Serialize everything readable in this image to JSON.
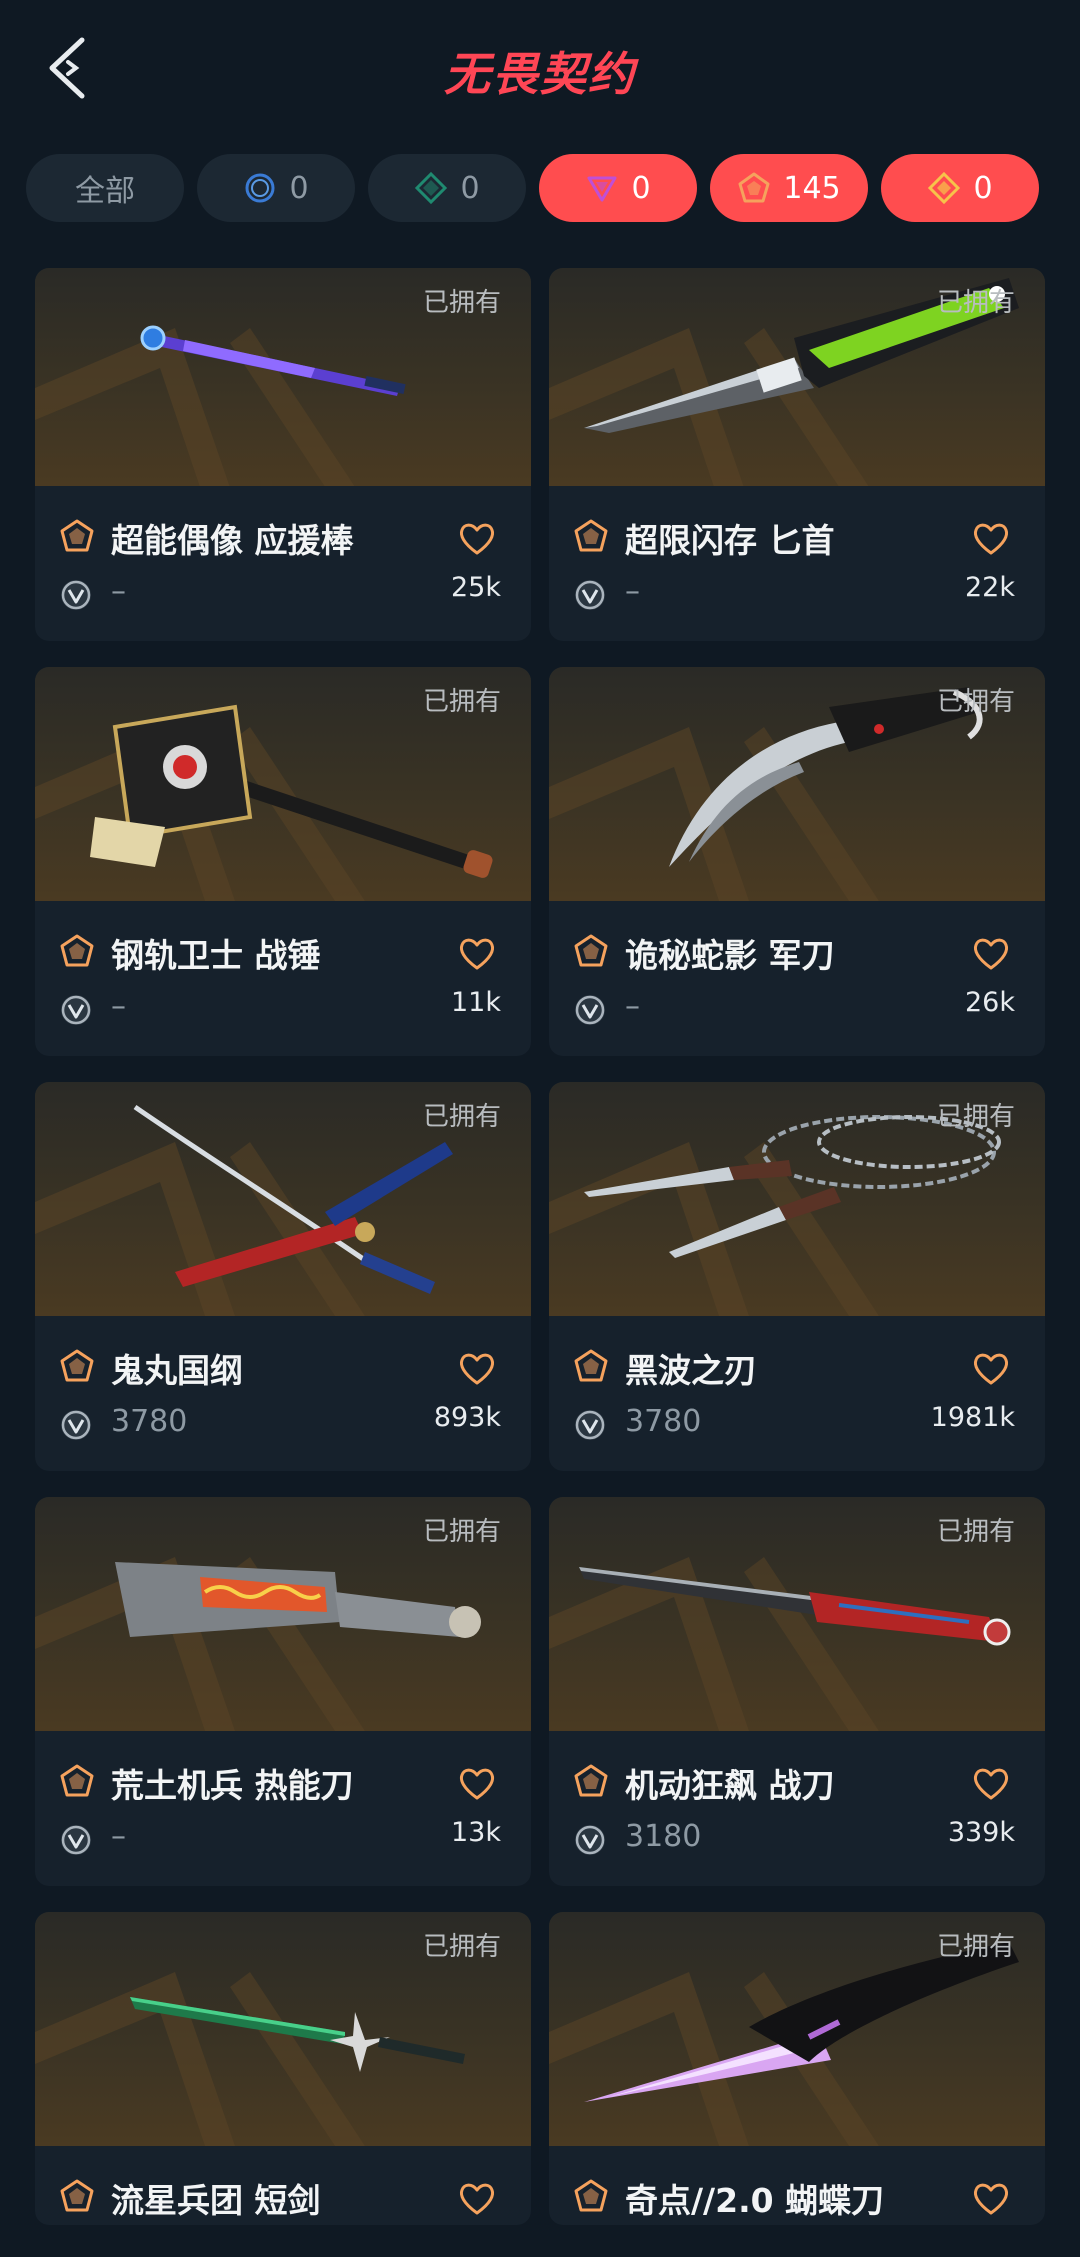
{
  "header": {
    "title": "无畏契约"
  },
  "filters": [
    {
      "label": "全部",
      "count": null,
      "active": false
    },
    {
      "icon": "circle-ring-icon",
      "count": "0",
      "active": false,
      "color": "#3a7bd5"
    },
    {
      "icon": "diamond-green-icon",
      "count": "0",
      "active": false,
      "color": "#1f8a70"
    },
    {
      "icon": "triangle-purple-icon",
      "count": "0",
      "active": true,
      "color": "#c04fd6"
    },
    {
      "icon": "pentagon-orange-icon",
      "count": "145",
      "active": true,
      "color": "#f5a25d"
    },
    {
      "icon": "diamond-yellow-icon",
      "count": "0",
      "active": true,
      "color": "#f7c34a"
    }
  ],
  "owned_label": "已拥有",
  "items": [
    {
      "name": "超能偶像 应援棒",
      "price": "–",
      "likes": "25k"
    },
    {
      "name": "超限闪存 匕首",
      "price": "–",
      "likes": "22k"
    },
    {
      "name": "钢轨卫士 战锤",
      "price": "–",
      "likes": "11k"
    },
    {
      "name": "诡秘蛇影 军刀",
      "price": "–",
      "likes": "26k"
    },
    {
      "name": "鬼丸国纲",
      "price": "3780",
      "likes": "893k"
    },
    {
      "name": "黑波之刃",
      "price": "3780",
      "likes": "1981k"
    },
    {
      "name": "荒土机兵 热能刀",
      "price": "–",
      "likes": "13k"
    },
    {
      "name": "机动狂飙 战刀",
      "price": "3180",
      "likes": "339k"
    },
    {
      "name": "流星兵团 短剑",
      "price": "",
      "likes": ""
    },
    {
      "name": "奇点//2.0 蝴蝶刀",
      "price": "",
      "likes": ""
    }
  ],
  "colors": {
    "accent": "#ff4655",
    "tier": "#f5a25d",
    "bg": "#0f1923",
    "card": "#16212c"
  }
}
